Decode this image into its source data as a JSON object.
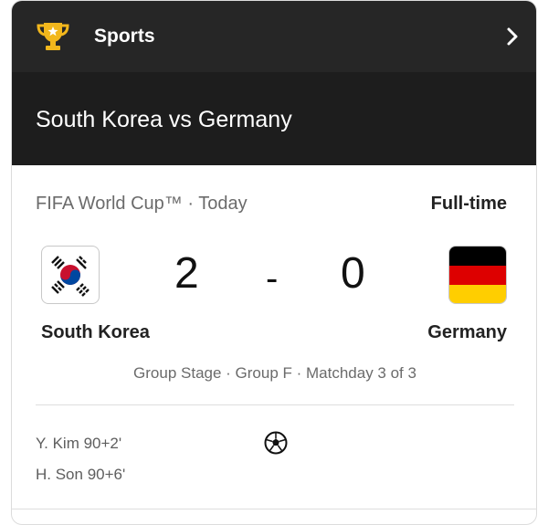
{
  "header": {
    "title": "Sports",
    "icon": "trophy-icon",
    "chevron_icon": "chevron-right-icon"
  },
  "match": {
    "title": "South Korea vs Germany",
    "competition": "FIFA World Cup™ · Today",
    "status": "Full-time",
    "home": {
      "name": "South Korea",
      "score": "2",
      "flag_icon": "south-korea-flag-icon"
    },
    "away": {
      "name": "Germany",
      "score": "0",
      "flag_icon": "germany-flag-icon"
    },
    "separator": "-",
    "stage": "Group Stage · Group F · Matchday 3 of 3",
    "goal_icon": "soccer-ball-icon",
    "scorers": [
      "Y. Kim 90+2'",
      "H. Son 90+6'"
    ]
  },
  "colors": {
    "header_bg": "#262626",
    "title_bg": "#1d1d1d",
    "trophy": "#f2b71c"
  }
}
